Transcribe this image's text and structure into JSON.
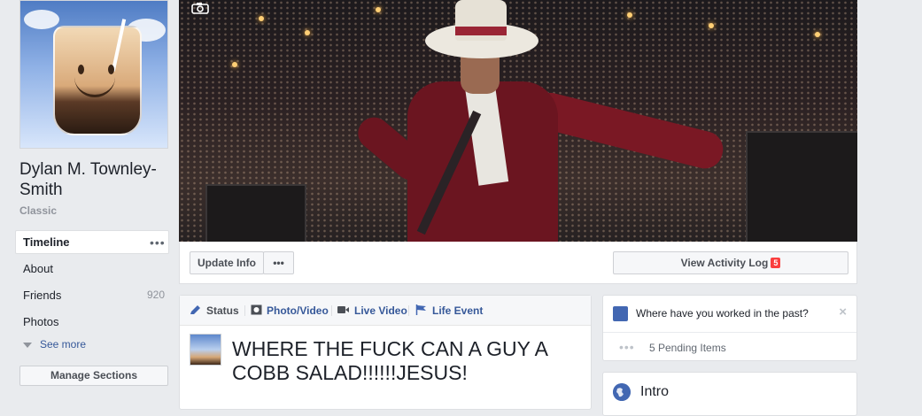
{
  "profile": {
    "name": "Dylan M. Townley-Smith",
    "subtitle": "Classic"
  },
  "nav": {
    "items": [
      {
        "label": "Timeline",
        "active": true
      },
      {
        "label": "About"
      },
      {
        "label": "Friends",
        "count": "920"
      },
      {
        "label": "Photos"
      }
    ],
    "more_dots": "•••",
    "see_more": "See more",
    "manage_sections": "Manage Sections"
  },
  "actions": {
    "update_info": "Update Info",
    "more": "•••",
    "activity_log": "View Activity Log",
    "activity_badge": "5"
  },
  "composer": {
    "tabs": [
      "Status",
      "Photo/Video",
      "Live Video",
      "Life Event"
    ],
    "post_text": "WHERE THE FUCK CAN A GUY A COBB SALAD!!!!!!JESUS!"
  },
  "work_prompt": {
    "question": "Where have you worked in the past?",
    "close": "×",
    "pending_dots": "•••",
    "pending": "5 Pending Items"
  },
  "intro": {
    "title": "Intro"
  },
  "colors": {
    "link": "#365899",
    "brand": "#4267b2",
    "badge": "#fa3e3e",
    "background": "#e9ebee"
  }
}
